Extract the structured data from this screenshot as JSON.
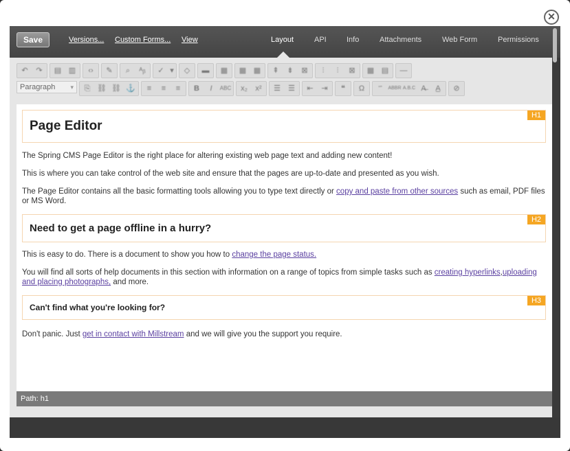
{
  "window": {
    "close_symbol": "✕"
  },
  "topbar": {
    "save_label": "Save",
    "links": [
      "Versions...",
      "Custom Forms...",
      "View"
    ],
    "tabs": [
      "Layout",
      "API",
      "Info",
      "Attachments",
      "Web Form",
      "Permissions"
    ],
    "active_tab": "Layout"
  },
  "toolbar": {
    "format_select": "Paragraph"
  },
  "content": {
    "h1": {
      "tag": "H1",
      "text": "Page Editor"
    },
    "p1": "The Spring CMS Page Editor is the right place for altering existing web page text and adding new content!",
    "p2": "This is where you can take control of the web site and ensure that the pages are up-to-date and presented as you wish.",
    "p3": {
      "before": "The Page Editor contains all the basic formatting tools allowing you to type text directly or ",
      "link": "copy and paste from other sources",
      "after": " such as email, PDF files or MS Word."
    },
    "h2": {
      "tag": "H2",
      "text": "Need to get a page offline in a hurry?"
    },
    "p4": {
      "before": "This is easy to do. There is a document to show you how to ",
      "link": "change the page status."
    },
    "p5": {
      "before": "You will find all sorts of help documents in this section with information on a range of topics from simple tasks such as ",
      "link1": "creating hyperlinks",
      "sep": ",",
      "link2": "uploading and placing photographs,",
      "after": " and more."
    },
    "h3": {
      "tag": "H3",
      "text": "Can't find what you're looking for?"
    },
    "p6": {
      "before": "Don't panic. Just ",
      "link": "get in contact with Millstream",
      "after": " and we will give you the support you require."
    }
  },
  "pathbar": {
    "text": "Path: h1"
  }
}
